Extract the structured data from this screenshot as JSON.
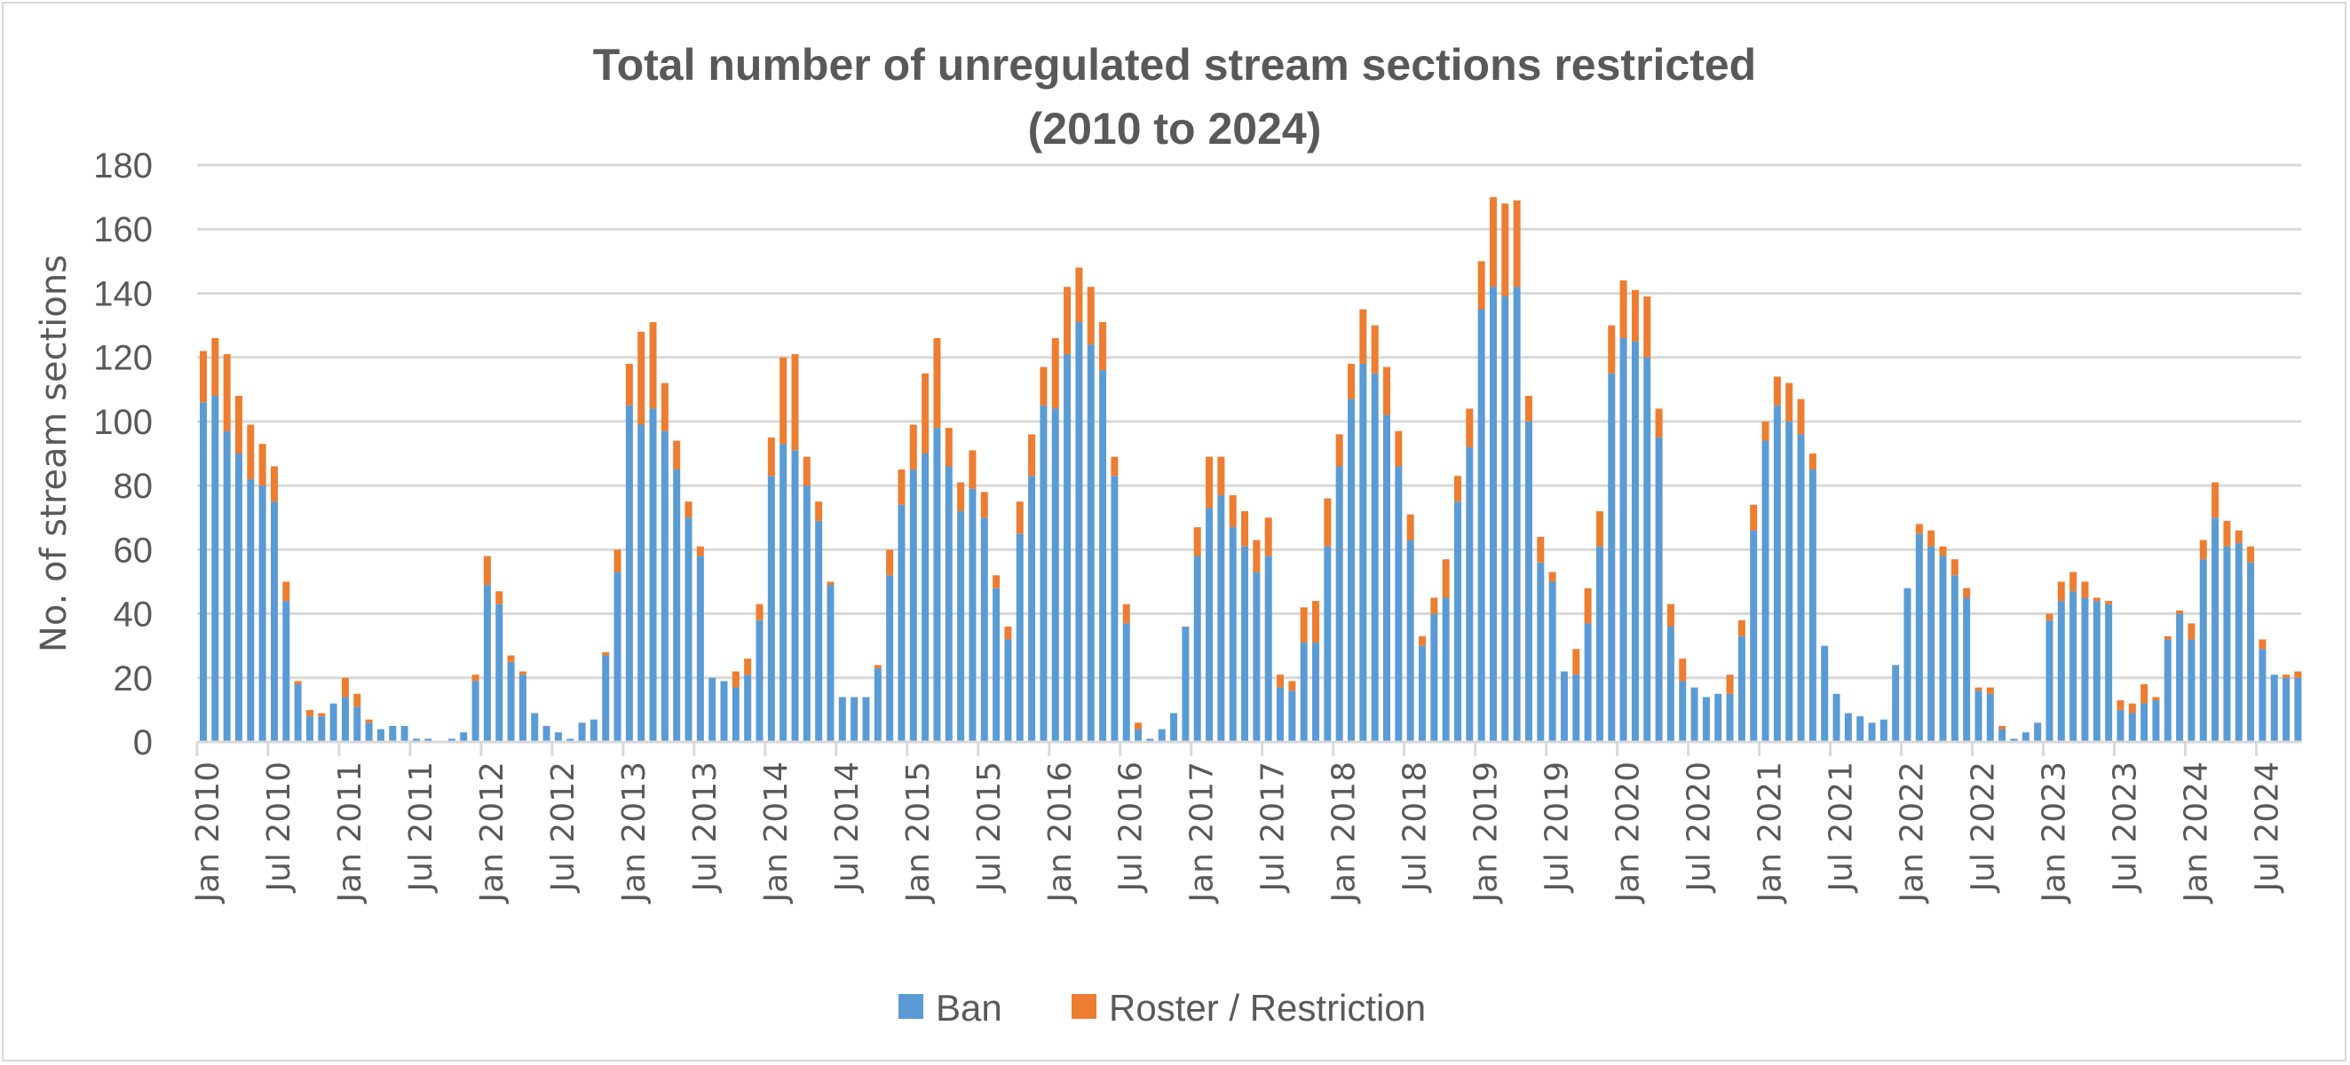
{
  "chart_data": {
    "type": "bar",
    "stacked": true,
    "title": "Total number of unregulated stream sections restricted",
    "subtitle": "(2010 to 2024)",
    "xlabel": "",
    "ylabel": "No. of stream sections",
    "ylim": [
      0,
      180
    ],
    "yticks": [
      0,
      20,
      40,
      60,
      80,
      100,
      120,
      140,
      160,
      180
    ],
    "grid": true,
    "legend_position": "bottom",
    "start_month": "Jan 2010",
    "end_month": "Oct 2024",
    "x_tick_labels": [
      "Jan 2010",
      "Jul 2010",
      "Jan 2011",
      "Jul 2011",
      "Jan 2012",
      "Jul 2012",
      "Jan 2013",
      "Jul 2013",
      "Jan 2014",
      "Jul 2014",
      "Jan 2015",
      "Jul 2015",
      "Jan 2016",
      "Jul 2016",
      "Jan 2017",
      "Jul 2017",
      "Jan 2018",
      "Jul 2018",
      "Jan 2019",
      "Jul 2019",
      "Jan 2020",
      "Jul 2020",
      "Jan 2021",
      "Jul 2021",
      "Jan 2022",
      "Jul 2022",
      "Jan 2023",
      "Jul 2023",
      "Jan 2024",
      "Jul 2024"
    ],
    "series": [
      {
        "name": "Ban",
        "color": "#5b9bd5",
        "values": [
          106,
          108,
          97,
          90,
          82,
          80,
          75,
          44,
          18,
          8,
          8,
          12,
          14,
          11,
          6,
          4,
          5,
          5,
          1,
          1,
          0,
          1,
          3,
          19,
          49,
          43,
          25,
          21,
          9,
          5,
          3,
          1,
          6,
          7,
          27,
          53,
          105,
          99,
          104,
          97,
          85,
          70,
          58,
          20,
          19,
          17,
          21,
          38,
          83,
          93,
          91,
          80,
          69,
          49,
          14,
          14,
          14,
          23,
          52,
          74,
          85,
          90,
          98,
          86,
          72,
          79,
          70,
          48,
          32,
          65,
          83,
          105,
          104,
          121,
          131,
          124,
          116,
          83,
          37,
          4,
          1,
          4,
          9,
          36,
          58,
          73,
          77,
          67,
          61,
          53,
          58,
          17,
          16,
          31,
          31,
          61,
          86,
          107,
          118,
          115,
          102,
          86,
          63,
          30,
          40,
          45,
          75,
          92,
          135,
          142,
          139,
          142,
          100,
          56,
          50,
          22,
          21,
          37,
          61,
          115,
          126,
          125,
          120,
          95,
          36,
          19,
          17,
          14,
          15,
          15,
          33,
          66,
          94,
          105,
          100,
          96,
          85,
          30,
          15,
          9,
          8,
          6,
          7,
          24,
          48,
          65,
          61,
          58,
          52,
          45,
          16,
          15,
          4,
          1,
          3,
          6,
          38,
          44,
          47,
          45,
          44,
          43,
          10,
          9,
          12,
          13,
          32,
          40,
          32,
          57,
          70,
          61,
          62,
          56,
          29,
          21,
          20,
          20
        ]
      },
      {
        "name": "Roster / Restriction",
        "color": "#ed7d31",
        "values": [
          16,
          18,
          24,
          18,
          17,
          13,
          11,
          6,
          1,
          2,
          1,
          0,
          6,
          4,
          1,
          0,
          0,
          0,
          0,
          0,
          0,
          0,
          0,
          2,
          9,
          4,
          2,
          1,
          0,
          0,
          0,
          0,
          0,
          0,
          1,
          7,
          13,
          29,
          27,
          15,
          9,
          5,
          3,
          0,
          0,
          5,
          5,
          5,
          12,
          27,
          30,
          9,
          6,
          1,
          0,
          0,
          0,
          1,
          8,
          11,
          14,
          25,
          28,
          12,
          9,
          12,
          8,
          4,
          4,
          10,
          13,
          12,
          22,
          21,
          17,
          18,
          15,
          6,
          6,
          2,
          0,
          0,
          0,
          0,
          9,
          16,
          12,
          10,
          11,
          10,
          12,
          4,
          3,
          11,
          13,
          15,
          10,
          11,
          17,
          15,
          15,
          11,
          8,
          3,
          5,
          12,
          8,
          12,
          15,
          28,
          29,
          27,
          8,
          8,
          3,
          0,
          8,
          11,
          11,
          15,
          18,
          16,
          19,
          9,
          7,
          7,
          0,
          0,
          0,
          6,
          5,
          8,
          6,
          9,
          12,
          11,
          5,
          0,
          0,
          0,
          0,
          0,
          0,
          0,
          0,
          3,
          5,
          3,
          5,
          3,
          1,
          2,
          1,
          0,
          0,
          0,
          2,
          6,
          6,
          5,
          1,
          1,
          3,
          3,
          6,
          1,
          1,
          1,
          5,
          6,
          11,
          8,
          4,
          5,
          3,
          0,
          1,
          2
        ]
      }
    ]
  }
}
